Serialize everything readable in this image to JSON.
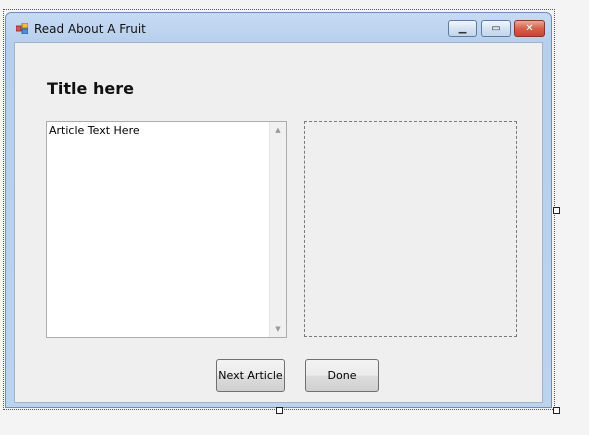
{
  "window": {
    "title": "Read About A Fruit",
    "minimize_glyph": "▁",
    "maximize_glyph": "▭",
    "close_glyph": "✕"
  },
  "form": {
    "title": "Title here",
    "article_text": "Article Text Here",
    "scroll_up_glyph": "▲",
    "scroll_down_glyph": "▼",
    "next_button_label": "Next Article",
    "done_button_label": "Done"
  },
  "colors": {
    "titlebar": "#c7dbf3",
    "client_background": "#efefef",
    "close_button": "#d8604a"
  }
}
